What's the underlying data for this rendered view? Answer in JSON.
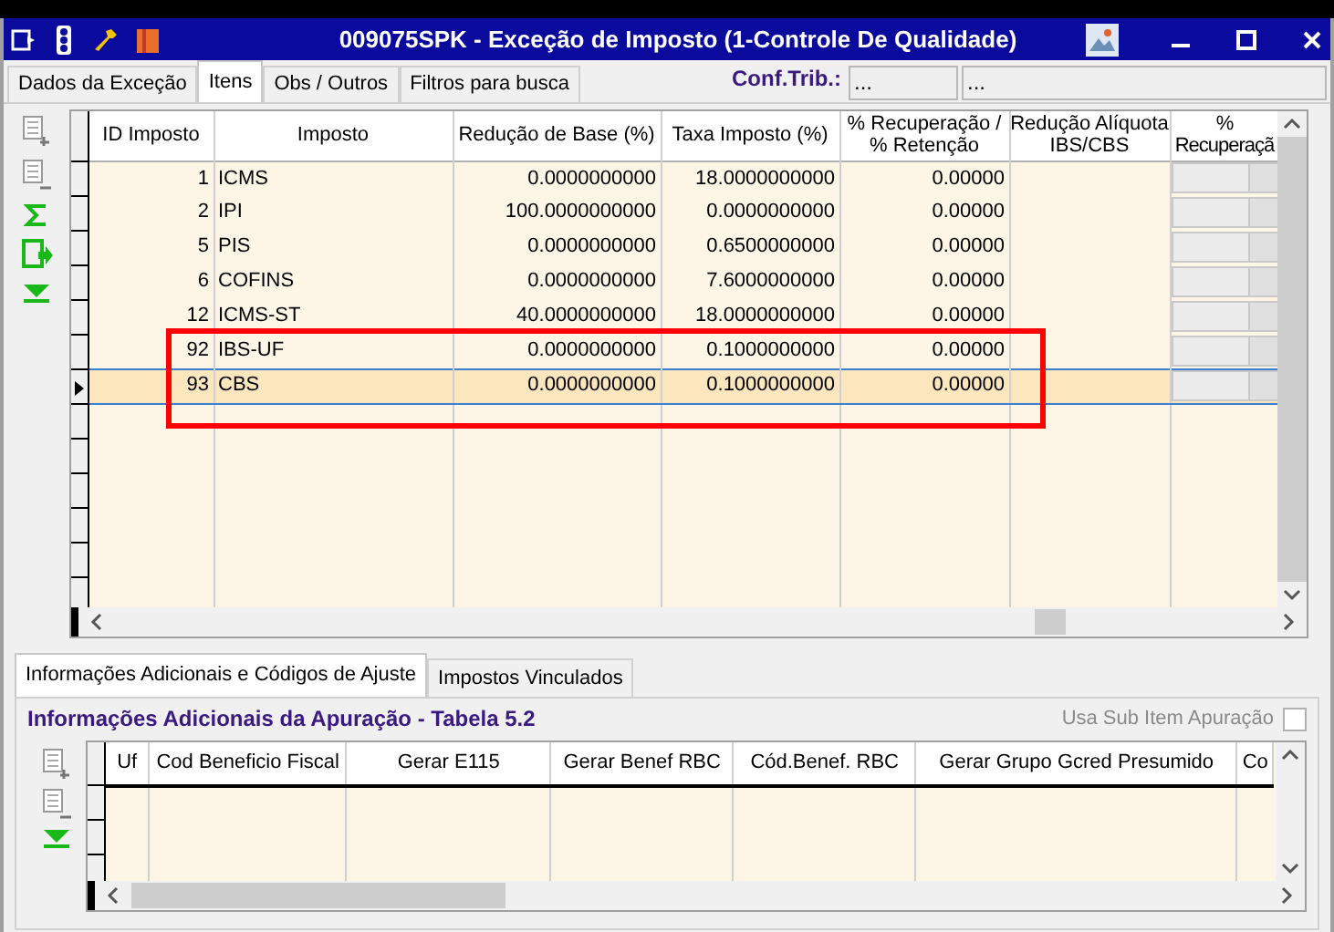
{
  "window": {
    "title": "009075SPK - Exceção de Imposto (1-Controle De Qualidade)"
  },
  "tabs": [
    {
      "label": "Dados da Exceção",
      "selected": false
    },
    {
      "label": "Itens",
      "selected": true
    },
    {
      "label": "Obs / Outros",
      "selected": false
    },
    {
      "label": "Filtros para busca",
      "selected": false
    }
  ],
  "conf_trib": {
    "label": "Conf.Trib.:",
    "fields": [
      "...",
      "..."
    ]
  },
  "items_table": {
    "columns": [
      "ID Imposto",
      "Imposto",
      "Redução de Base (%)",
      "Taxa Imposto (%)",
      "% Recuperação / % Retenção",
      "Redução Alíquota IBS/CBS",
      "% Recuperaçã"
    ],
    "rows": [
      {
        "id": "1",
        "imposto": "ICMS",
        "reducao_base": "0.0000000000",
        "taxa": "18.0000000000",
        "recuperacao": "0.00000",
        "selected": false
      },
      {
        "id": "2",
        "imposto": "IPI",
        "reducao_base": "100.0000000000",
        "taxa": "0.0000000000",
        "recuperacao": "0.00000",
        "selected": false
      },
      {
        "id": "5",
        "imposto": "PIS",
        "reducao_base": "0.0000000000",
        "taxa": "0.6500000000",
        "recuperacao": "0.00000",
        "selected": false
      },
      {
        "id": "6",
        "imposto": "COFINS",
        "reducao_base": "0.0000000000",
        "taxa": "7.6000000000",
        "recuperacao": "0.00000",
        "selected": false
      },
      {
        "id": "12",
        "imposto": "ICMS-ST",
        "reducao_base": "40.0000000000",
        "taxa": "18.0000000000",
        "recuperacao": "0.00000",
        "selected": false
      },
      {
        "id": "92",
        "imposto": "IBS-UF",
        "reducao_base": "0.0000000000",
        "taxa": "0.1000000000",
        "recuperacao": "0.00000",
        "selected": false
      },
      {
        "id": "93",
        "imposto": "CBS",
        "reducao_base": "0.0000000000",
        "taxa": "0.1000000000",
        "recuperacao": "0.00000",
        "selected": true
      }
    ]
  },
  "lower_tabs": [
    {
      "label": "Informações Adicionais e Códigos de Ajuste",
      "selected": true
    },
    {
      "label": "Impostos Vinculados",
      "selected": false
    }
  ],
  "panel_title": "Informações Adicionais da Apuração - Tabela 5.2",
  "sub_item": {
    "label": "Usa Sub Item Apuração",
    "checked": false
  },
  "adjust_table": {
    "columns": [
      "Uf",
      "Cod Beneficio Fiscal",
      "Gerar E115",
      "Gerar Benef RBC",
      "Cód.Benef. RBC",
      "Gerar Grupo Gcred Presumido",
      "Co"
    ]
  }
}
